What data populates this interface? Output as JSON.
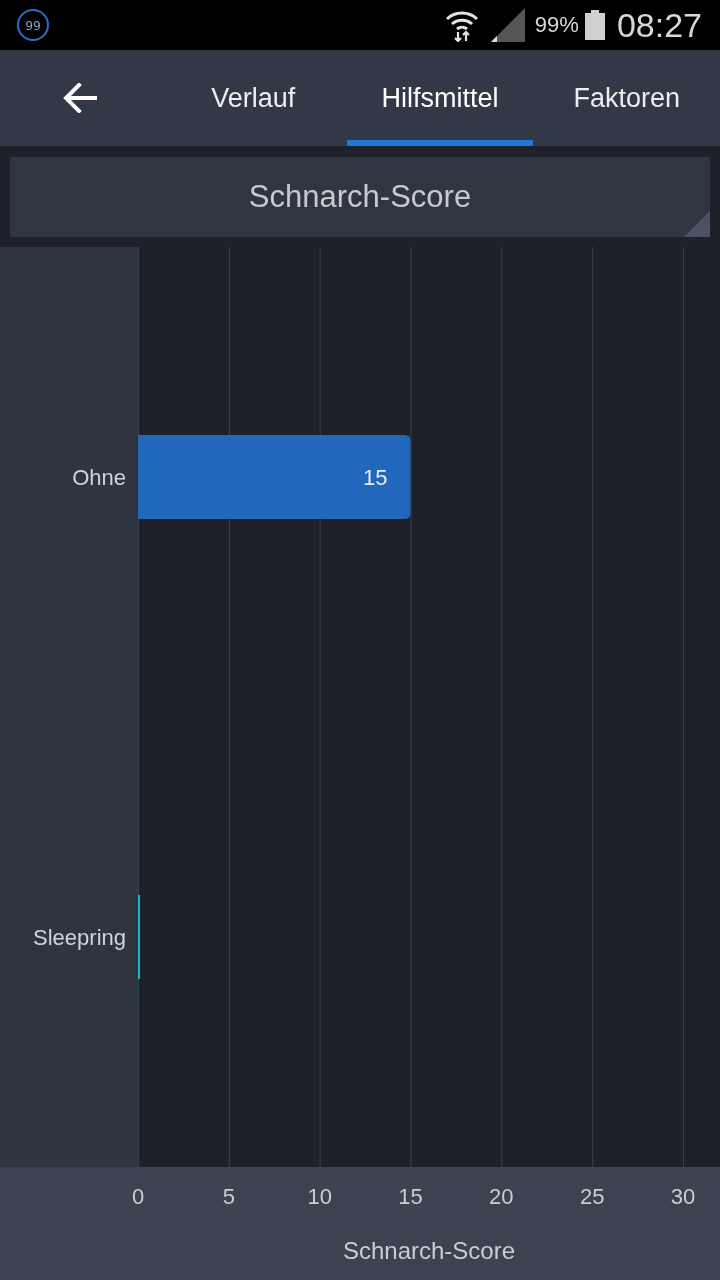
{
  "status_bar": {
    "badge": "99",
    "battery": "99%",
    "time": "08:27"
  },
  "tabs": [
    {
      "label": "Verlauf",
      "selected": false
    },
    {
      "label": "Hilfsmittel",
      "selected": true
    },
    {
      "label": "Faktoren",
      "selected": false
    }
  ],
  "metric_selector": {
    "value": "Schnarch-Score"
  },
  "chart": {
    "chart_data": {
      "type": "bar",
      "orientation": "horizontal",
      "categories": [
        "Ohne",
        "Sleepring"
      ],
      "series": [
        {
          "color": "#2167bb",
          "values": [
            15,
            null
          ]
        },
        {
          "color": "#22b5c2",
          "values": [
            null,
            0
          ]
        }
      ],
      "xlabel": "Schnarch-Score",
      "xlim": [
        0,
        30
      ],
      "xticks": [
        0,
        5,
        10,
        15,
        20,
        25,
        30
      ],
      "grid": true,
      "value_labels": [
        "15",
        null
      ]
    }
  }
}
